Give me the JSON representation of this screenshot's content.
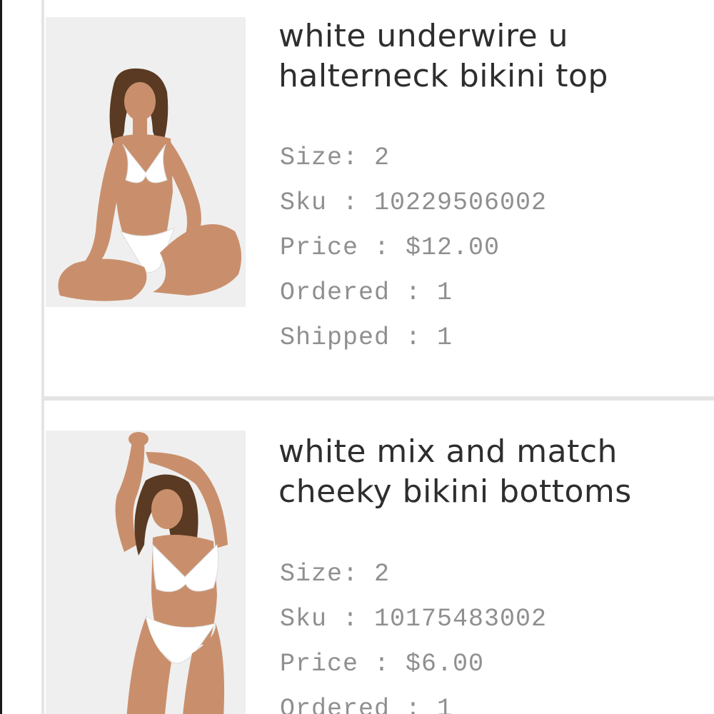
{
  "items": [
    {
      "name_line1": "white underwire u",
      "name_line2": "halterneck bikini top",
      "size": "Size: 2",
      "sku": "Sku : 10229506002",
      "price": "Price : $12.00",
      "ordered": "Ordered : 1",
      "shipped": "Shipped : 1",
      "image_label": "product-photo"
    },
    {
      "name_line1": "white mix and match",
      "name_line2": "cheeky bikini bottoms",
      "size": "Size: 2",
      "sku": "Sku : 10175483002",
      "price": "Price : $6.00",
      "ordered": "Ordered : 1",
      "image_label": "product-photo"
    }
  ],
  "colors": {
    "title": "#2e2e2e",
    "detail": "#8f8f8f",
    "divider": "#e4e4e4",
    "photo_bg": "#efefef",
    "swimwear": "#ffffff",
    "skin": "#c98f6c",
    "hair": "#5a3a22"
  }
}
